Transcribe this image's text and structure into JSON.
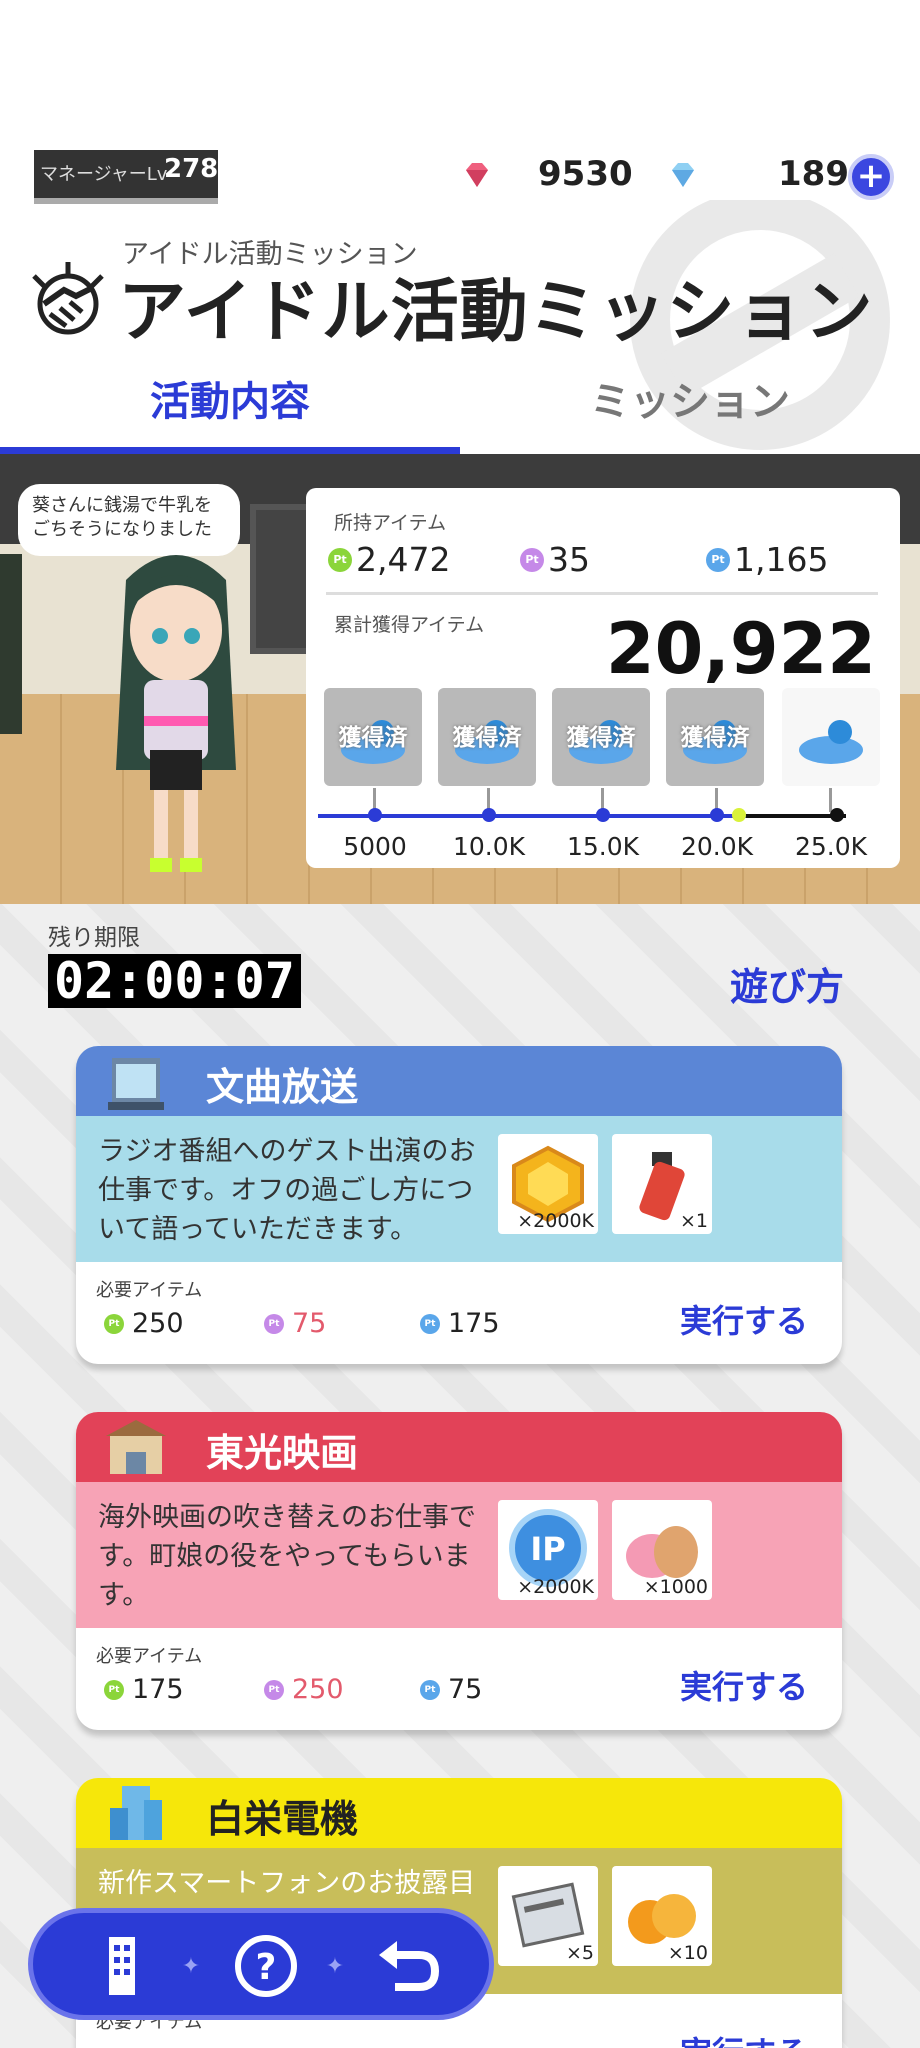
{
  "header": {
    "manager_label": "マネージャーLv",
    "manager_level": "278",
    "currency1": "9530",
    "currency2": "189",
    "plus_icon": "plus-icon",
    "gem_red_color": "#e4506e",
    "gem_blue_color": "#5fa8e8"
  },
  "title": {
    "small": "アイドル活動ミッション",
    "big": "アイドル活動ミッション"
  },
  "tabs": [
    "活動内容",
    "ミッション"
  ],
  "scene": {
    "speech": "葵さんに銭湯で牛乳を\nごちそうになりました"
  },
  "panel": {
    "owned_label": "所持アイテム",
    "owned": [
      {
        "coin": "Pt",
        "color": "#8bd53a",
        "value": "2,472"
      },
      {
        "coin": "Pt",
        "color": "#c589e8",
        "value": "35"
      },
      {
        "coin": "Pt",
        "color": "#5aa6ea",
        "value": "1,165"
      }
    ],
    "total_label": "累計獲得アイテム",
    "total": "20,922",
    "acquired_label": "獲得済",
    "milestones": [
      "5000",
      "10.0K",
      "15.0K",
      "20.0K",
      "25.0K"
    ],
    "progress_fraction": 0.8369
  },
  "deadline": {
    "label": "残り期限",
    "timer": "02:00:07",
    "howto": "遊び方"
  },
  "cards": [
    {
      "name": "文曲放送",
      "head_color": "#5b86d6",
      "desc_color": "#a8dcea",
      "desc": "ラジオ番組へのゲスト出演のお仕事です。オフの過ごし方について語っていただきます。",
      "rewards": [
        "×2000K",
        "×1"
      ],
      "req_label": "必要アイテム",
      "req": [
        "250",
        "75",
        "175"
      ],
      "exec": "実行する"
    },
    {
      "name": "東光映画",
      "head_color": "#e24258",
      "desc_color": "#f7a3b6",
      "desc": "海外映画の吹き替えのお仕事です。町娘の役をやってもらいます。",
      "rewards": [
        "×2000K",
        "×1000"
      ],
      "req_label": "必要アイテム",
      "req": [
        "175",
        "250",
        "75"
      ],
      "exec": "実行する"
    },
    {
      "name": "白栄電機",
      "head_color": "#f6e70a",
      "desc_color": "#c8be5a",
      "desc": "新作スマートフォンのお披露目",
      "rewards": [
        "×5",
        "×10"
      ],
      "req_label": "必要アイテム",
      "req": [
        "",
        "",
        ""
      ],
      "exec": "実行する"
    }
  ]
}
